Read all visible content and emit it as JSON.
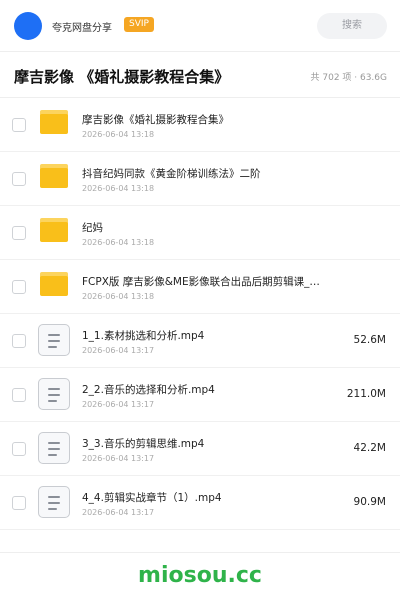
{
  "header": {
    "app_name": "夸克网盘分享",
    "badge": "SVIP",
    "search_label": "搜索",
    "colors": {
      "avatar": "#1e6ff5",
      "badge": "#f5a623"
    }
  },
  "share": {
    "title": "摩吉影像 《婚礼摄影教程合集》",
    "summary": "共 702 项 · 63.6G"
  },
  "files": [
    {
      "type": "folder",
      "icon": "folder-icon",
      "name": "摩吉影像《婚礼摄影教程合集》",
      "date": "2026-06-04 13:18",
      "size": ""
    },
    {
      "type": "folder",
      "icon": "folder-icon",
      "name": "抖音纪妈同款《黄金阶梯训练法》二阶",
      "date": "2026-06-04 13:18",
      "size": ""
    },
    {
      "type": "folder",
      "icon": "folder-icon",
      "name": "纪妈",
      "date": "2026-06-04 13:18",
      "size": ""
    },
    {
      "type": "folder",
      "icon": "folder-icon",
      "name": "FCPX版 摩吉影像&ME影像联合出品后期剪辑课_…",
      "date": "2026-06-04 13:18",
      "size": ""
    },
    {
      "type": "video",
      "icon": "document-icon",
      "name": "1_1.素材挑选和分析.mp4",
      "date": "2026-06-04 13:17",
      "size": "52.6M"
    },
    {
      "type": "video",
      "icon": "document-icon",
      "name": "2_2.音乐的选择和分析.mp4",
      "date": "2026-06-04 13:17",
      "size": "211.0M"
    },
    {
      "type": "video",
      "icon": "document-icon",
      "name": "3_3.音乐的剪辑思维.mp4",
      "date": "2026-06-04 13:17",
      "size": "42.2M"
    },
    {
      "type": "video",
      "icon": "document-icon",
      "name": "4_4.剪辑实战章节（1）.mp4",
      "date": "2026-06-04 13:17",
      "size": "90.9M"
    }
  ],
  "watermark": "miosou.cc"
}
